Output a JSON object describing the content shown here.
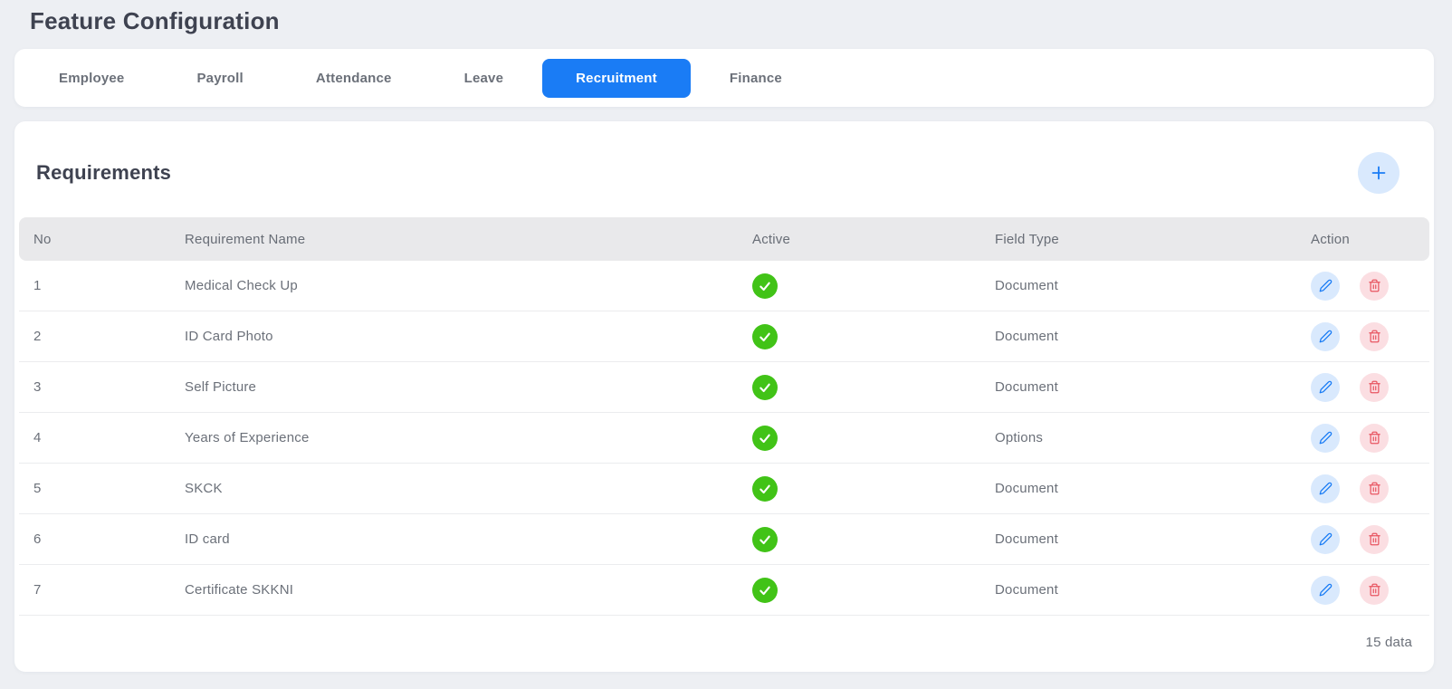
{
  "page_title": "Feature Configuration",
  "tabs": [
    {
      "label": "Employee",
      "active": false
    },
    {
      "label": "Payroll",
      "active": false
    },
    {
      "label": "Attendance",
      "active": false
    },
    {
      "label": "Leave",
      "active": false
    },
    {
      "label": "Recruitment",
      "active": true
    },
    {
      "label": "Finance",
      "active": false
    }
  ],
  "panel": {
    "title": "Requirements",
    "footer_count": "15 data"
  },
  "table": {
    "columns": [
      "No",
      "Requirement Name",
      "Active",
      "Field Type",
      "Action"
    ],
    "rows": [
      {
        "no": "1",
        "name": "Medical Check Up",
        "active": true,
        "field_type": "Document"
      },
      {
        "no": "2",
        "name": "ID Card Photo",
        "active": true,
        "field_type": "Document"
      },
      {
        "no": "3",
        "name": "Self Picture",
        "active": true,
        "field_type": "Document"
      },
      {
        "no": "4",
        "name": "Years of Experience",
        "active": true,
        "field_type": "Options"
      },
      {
        "no": "5",
        "name": "SKCK",
        "active": true,
        "field_type": "Document"
      },
      {
        "no": "6",
        "name": "ID card",
        "active": true,
        "field_type": "Document"
      },
      {
        "no": "7",
        "name": "Certificate SKKNI",
        "active": true,
        "field_type": "Document"
      }
    ]
  },
  "icons": {
    "add": "plus-icon",
    "active": "check-icon",
    "edit": "pencil-icon",
    "delete": "trash-icon"
  },
  "colors": {
    "accent_blue": "#1a7cf5",
    "accent_blue_light": "#d9e9fd",
    "success_green": "#41c317",
    "danger_red": "#e85561",
    "danger_red_light": "#fbdee2"
  }
}
